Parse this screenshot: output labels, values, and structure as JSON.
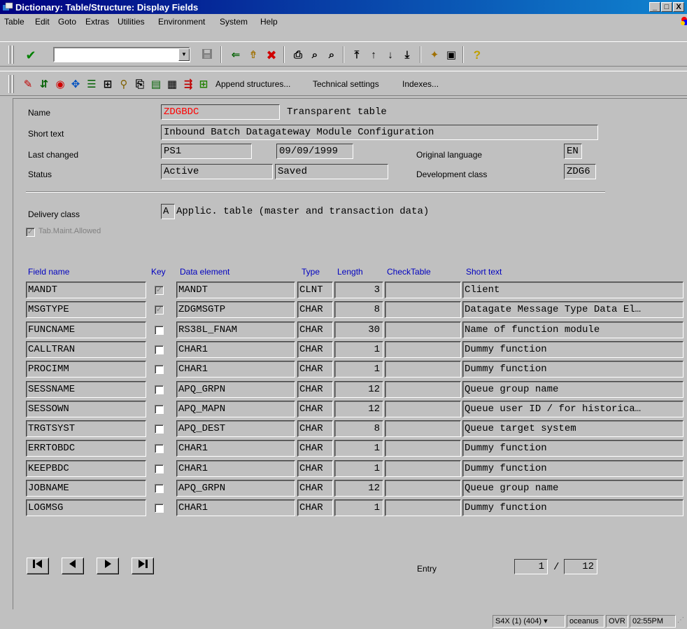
{
  "window": {
    "title": "Dictionary: Table/Structure: Display Fields",
    "minimize_glyph": "_",
    "maximize_glyph": "□",
    "close_glyph": "X"
  },
  "menu": [
    "Table",
    "Edit",
    "Goto",
    "Extras",
    "Utilities",
    "Environment",
    "System",
    "Help"
  ],
  "command_field": {
    "value": ""
  },
  "app_toolbar": {
    "append_structures": "Append structures...",
    "technical_settings": "Technical settings",
    "indexes": "Indexes..."
  },
  "header": {
    "name_label": "Name",
    "name_value": "ZDGBDC",
    "table_type": "Transparent table",
    "short_text_label": "Short text",
    "short_text_value": "Inbound Batch Datagateway Module Configuration",
    "last_changed_label": "Last changed",
    "last_changed_user": "PS1",
    "last_changed_date": "09/09/1999",
    "original_language_label": "Original language",
    "original_language_value": "EN",
    "status_label": "Status",
    "status_value": "Active",
    "status_saved": "Saved",
    "development_class_label": "Development class",
    "development_class_value": "ZDG6",
    "delivery_class_label": "Delivery class",
    "delivery_class_code": "A",
    "delivery_class_text": "Applic. table (master and transaction data)",
    "tab_maint_label": "Tab.Maint.Allowed",
    "tab_maint_checked": true
  },
  "table": {
    "columns": [
      "Field name",
      "Key",
      "Data element",
      "Type",
      "Length",
      "CheckTable",
      "Short text"
    ],
    "rows": [
      {
        "field": "MANDT",
        "key": true,
        "element": "MANDT",
        "type": "CLNT",
        "length": "3",
        "check": "",
        "text": "Client"
      },
      {
        "field": "MSGTYPE",
        "key": true,
        "element": "ZDGMSGTP",
        "type": "CHAR",
        "length": "8",
        "check": "",
        "text": "Datagate Message Type Data El…"
      },
      {
        "field": "FUNCNAME",
        "key": false,
        "element": "RS38L_FNAM",
        "type": "CHAR",
        "length": "30",
        "check": "",
        "text": "Name of function module"
      },
      {
        "field": "CALLTRAN",
        "key": false,
        "element": "CHAR1",
        "type": "CHAR",
        "length": "1",
        "check": "",
        "text": "Dummy function"
      },
      {
        "field": "PROCIMM",
        "key": false,
        "element": "CHAR1",
        "type": "CHAR",
        "length": "1",
        "check": "",
        "text": "Dummy function"
      },
      {
        "field": "SESSNAME",
        "key": false,
        "element": "APQ_GRPN",
        "type": "CHAR",
        "length": "12",
        "check": "",
        "text": "Queue group name"
      },
      {
        "field": "SESSOWN",
        "key": false,
        "element": "APQ_MAPN",
        "type": "CHAR",
        "length": "12",
        "check": "",
        "text": "Queue user ID / for historica…"
      },
      {
        "field": "TRGTSYST",
        "key": false,
        "element": "APQ_DEST",
        "type": "CHAR",
        "length": "8",
        "check": "",
        "text": "Queue target system"
      },
      {
        "field": "ERRTOBDC",
        "key": false,
        "element": "CHAR1",
        "type": "CHAR",
        "length": "1",
        "check": "",
        "text": "Dummy function"
      },
      {
        "field": "KEEPBDC",
        "key": false,
        "element": "CHAR1",
        "type": "CHAR",
        "length": "1",
        "check": "",
        "text": "Dummy function"
      },
      {
        "field": "JOBNAME",
        "key": false,
        "element": "APQ_GRPN",
        "type": "CHAR",
        "length": "12",
        "check": "",
        "text": "Queue group name"
      },
      {
        "field": "LOGMSG",
        "key": false,
        "element": "CHAR1",
        "type": "CHAR",
        "length": "1",
        "check": "",
        "text": "Dummy function"
      }
    ]
  },
  "pager": {
    "entry_label": "Entry",
    "current": "1",
    "separator": "/",
    "total": "12",
    "first_glyph": "|◀",
    "prev_glyph": "◀",
    "next_glyph": "▶",
    "last_glyph": "▶|"
  },
  "statusbar": {
    "system": "S4X (1) (404)",
    "server": "oceanus",
    "mode": "OVR",
    "time": "02:55PM"
  },
  "colors": {
    "title_start": "#000080",
    "title_end": "#1084d0",
    "name_value": "#ff0000",
    "column_header": "#0000c0",
    "face": "#c0c0c0"
  },
  "icons": {
    "system_toolbar": [
      "enter-check-icon",
      "save-icon",
      "back-arrow-icon",
      "exit-up-icon",
      "cancel-x-icon",
      "print-icon",
      "find-icon",
      "find-next-icon",
      "first-page-icon",
      "previous-page-icon",
      "next-page-icon",
      "last-page-icon",
      "create-session-icon",
      "shortcut-icon",
      "help-icon"
    ],
    "app_toolbar": [
      "display-change-icon",
      "other-object-icon",
      "check-icon",
      "activate-icon",
      "where-used-icon",
      "object-list-icon",
      "documentation-icon",
      "new-entries-icon",
      "contents-icon",
      "utilities-icon",
      "search-help-icon",
      "foreign-keys-icon"
    ]
  }
}
